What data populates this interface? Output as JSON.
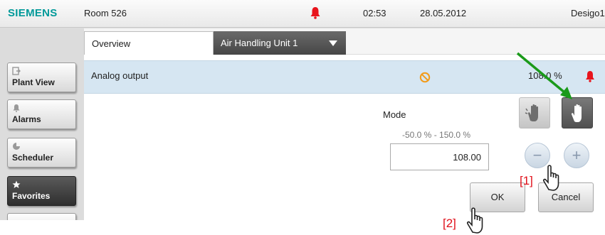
{
  "topbar": {
    "brand": "SIEMENS",
    "room": "Room 526",
    "time": "02:53",
    "date": "28.05.2012",
    "site": "Desigo1",
    "alarm_icon": "bell-icon",
    "alarm_color": "#e8141c",
    "brand_color": "#009999"
  },
  "tabs": {
    "overview": "Overview",
    "unit": "Air Handling Unit 1"
  },
  "sidebar": {
    "items": [
      {
        "label": "Plant View",
        "icon": "plant-view-icon",
        "active": false
      },
      {
        "label": "Alarms",
        "icon": "bell-icon",
        "active": false
      },
      {
        "label": "Scheduler",
        "icon": "scheduler-icon",
        "active": false
      },
      {
        "label": "Favorites",
        "icon": "star-icon",
        "active": true
      }
    ]
  },
  "point": {
    "label": "Analog output",
    "value": "108.0 %",
    "status_icon": "forbidden-icon"
  },
  "editor": {
    "mode_label": "Mode",
    "range": "-50.0 % - 150.0 %",
    "value": "108.00",
    "minus": "−",
    "plus": "+",
    "ok": "OK",
    "cancel": "Cancel"
  },
  "annotations": {
    "step1": "[1]",
    "step2": "[2]",
    "arrow_color": "#1a9a1a",
    "callout_color": "#e0101a"
  }
}
